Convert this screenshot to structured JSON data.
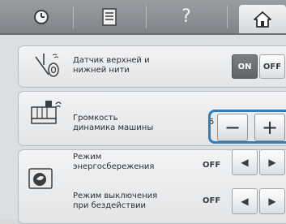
{
  "tabs": [
    {
      "name": "clock-icon"
    },
    {
      "name": "document-icon"
    },
    {
      "name": "help-icon",
      "label": "?"
    },
    {
      "name": "home-icon"
    }
  ],
  "settings": {
    "thread_sensor": {
      "label": "Датчик верхней и\nнижней нити",
      "on_label": "ON",
      "off_label": "OFF",
      "state": "ON"
    },
    "speaker_volume": {
      "label": "Громкость\nдинамика машины",
      "level": "5",
      "minus_label": "−",
      "plus_label": "+"
    },
    "eco_mode": {
      "label": "Режим\nэнергосбережения",
      "value": "OFF",
      "left_label": "◀",
      "right_label": "▶"
    },
    "idle_shutdown": {
      "label": "Режим выключения\nпри бездействии",
      "value": "OFF",
      "left_label": "◀",
      "right_label": "▶"
    }
  },
  "colors": {
    "highlight": "#2d7fc0",
    "topbar": "#8a8f94"
  }
}
